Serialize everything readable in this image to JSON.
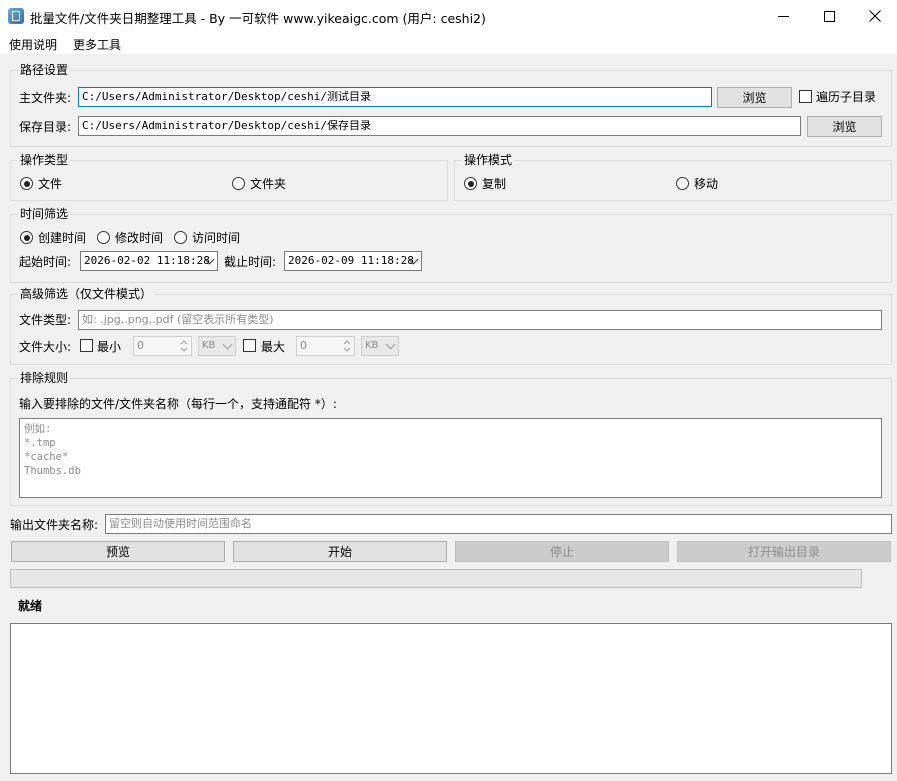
{
  "window": {
    "title": "批量文件/文件夹日期整理工具 - By 一可软件 www.yikeaigc.com (用户: ceshi2)"
  },
  "menu": {
    "items": [
      "使用说明",
      "更多工具"
    ]
  },
  "path_settings": {
    "title": "路径设置",
    "main_folder_label": "主文件夹:",
    "main_folder_value": "C:/Users/Administrator/Desktop/ceshi/测试目录",
    "browse_label": "浏览",
    "recursive_label": "遍历子目录",
    "recursive_checked": false,
    "save_dir_label": "保存目录:",
    "save_dir_value": "C:/Users/Administrator/Desktop/ceshi/保存目录",
    "browse2_label": "浏览"
  },
  "operation_type": {
    "title": "操作类型",
    "options": [
      "文件",
      "文件夹"
    ],
    "selected": "文件"
  },
  "operation_mode": {
    "title": "操作模式",
    "options": [
      "复制",
      "移动"
    ],
    "selected": "复制"
  },
  "time_filter": {
    "title": "时间筛选",
    "options": [
      "创建时间",
      "修改时间",
      "访问时间"
    ],
    "selected": "创建时间",
    "start_label": "起始时间:",
    "start_value": "2026-02-02 11:18:28",
    "end_label": "截止时间:",
    "end_value": "2026-02-09 11:18:28"
  },
  "advanced_filter": {
    "title": "高级筛选（仅文件模式）",
    "file_type_label": "文件类型:",
    "file_type_placeholder": "如: .jpg,.png,.pdf (留空表示所有类型)",
    "file_size_label": "文件大小:",
    "min_label": "最小",
    "min_value": "0",
    "min_unit": "KB",
    "max_label": "最大",
    "max_value": "0",
    "max_unit": "KB"
  },
  "exclude_rules": {
    "title": "排除规则",
    "instruction": "输入要排除的文件/文件夹名称（每行一个，支持通配符 *）:",
    "placeholder": "例如:\n*.tmp\n*cache*\nThumbs.db"
  },
  "output": {
    "folder_name_label": "输出文件夹名称:",
    "folder_name_placeholder": "留空则自动使用时间范围命名"
  },
  "actions": {
    "preview": "预览",
    "start": "开始",
    "stop": "停止",
    "open_output": "打开输出目录"
  },
  "status": {
    "text": "就绪",
    "progress": 0
  }
}
